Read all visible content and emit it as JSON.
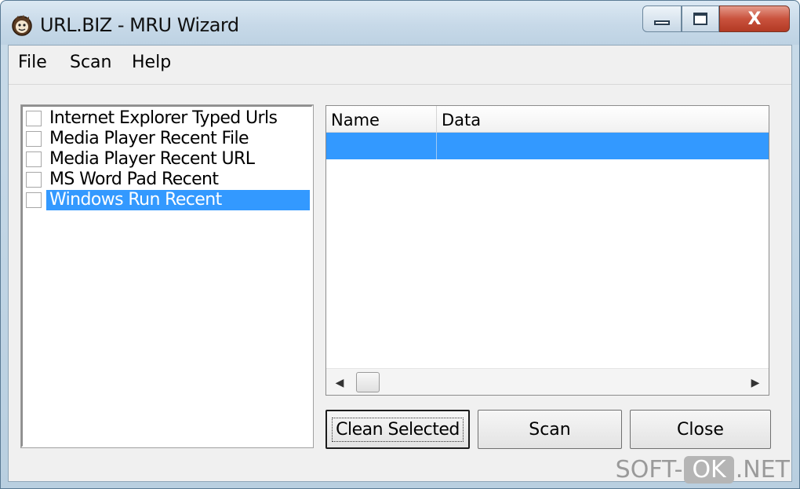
{
  "window": {
    "title": "URL.BIZ - MRU Wizard",
    "controls": {
      "minimize": "minimize",
      "maximize": "maximize",
      "close": "X"
    }
  },
  "menu": [
    {
      "label": "File"
    },
    {
      "label": "Scan"
    },
    {
      "label": "Help"
    }
  ],
  "mru_sources": [
    {
      "label": "Internet Explorer Typed Urls",
      "checked": false,
      "selected": false
    },
    {
      "label": "Media Player Recent File",
      "checked": false,
      "selected": false
    },
    {
      "label": "Media Player Recent URL",
      "checked": false,
      "selected": false
    },
    {
      "label": "MS Word Pad Recent",
      "checked": false,
      "selected": false
    },
    {
      "label": "Windows Run Recent",
      "checked": false,
      "selected": true
    }
  ],
  "list_view": {
    "columns": [
      "Name",
      "Data"
    ],
    "rows": [
      {
        "name": "",
        "data": "",
        "selected": true
      }
    ]
  },
  "buttons": {
    "clean_selected": "Clean Selected",
    "scan": "Scan",
    "close": "Close"
  },
  "watermark": {
    "left": "SOFT-",
    "middle": "OK",
    "right": ".NET"
  },
  "colors": {
    "selection": "#3399ff",
    "client_bg": "#f0f0f0",
    "close_button": "#c9523d"
  },
  "icons": [
    "app-icon",
    "minimize-icon",
    "maximize-icon",
    "close-icon",
    "scroll-left-icon",
    "scroll-right-icon"
  ]
}
